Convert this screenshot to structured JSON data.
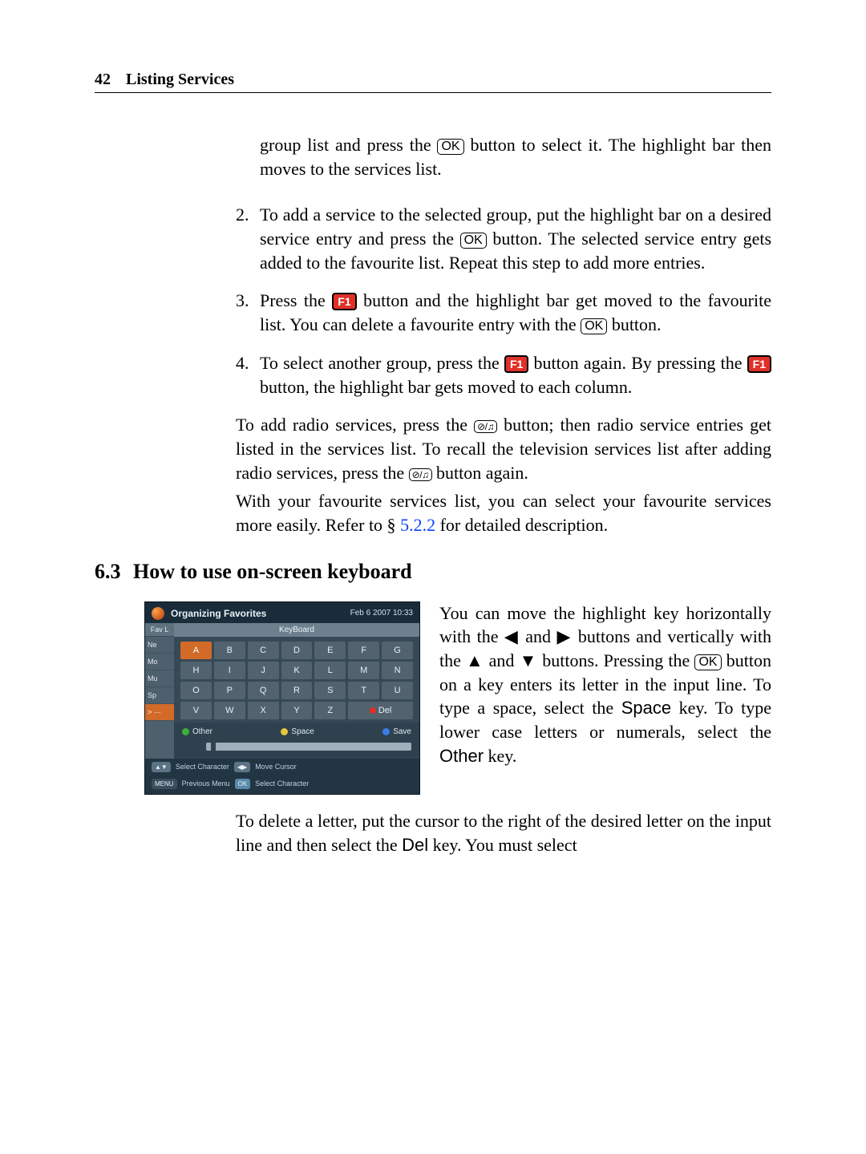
{
  "header": {
    "page_number": "42",
    "chapter_title": "Listing Services"
  },
  "keys": {
    "ok": "OK",
    "f1": "F1",
    "tvradio": "⊘/♫"
  },
  "content": {
    "intro_tail": "group list and press the ",
    "intro_tail_b": " button to select it. The highlight bar then moves to the services list.",
    "step2_a": "To add a service to the selected group, put the highlight bar on a desired service entry and press the ",
    "step2_b": " button. The selected service entry gets added to the favourite list. Repeat this step to add more entries.",
    "step3_a": "Press the ",
    "step3_b": " button and the highlight bar get moved to the favourite list. You can delete a favourite entry with the ",
    "step3_c": " button.",
    "step4_a": "To select another group, press the ",
    "step4_b": " button again. By pressing the ",
    "step4_c": " button, the highlight bar gets moved to each column.",
    "radio_a": "To add radio services, press the ",
    "radio_b": " button; then radio service entries get listed in the services list. To recall the television services list after adding radio services, press the ",
    "radio_c": " button again.",
    "fav_note_a": "With your favourite services list, you can select your favourite services more easily. Refer to § ",
    "fav_note_link": "5.2.2",
    "fav_note_b": " for detailed description.",
    "section_num": "6.3",
    "section_title": "How to use on-screen keyboard",
    "kb_para_a": "You can move the highlight key horizontally with the ",
    "kb_para_b": " and ",
    "kb_para_c": " buttons and vertically with the ",
    "kb_para_d": " and ",
    "kb_para_e": " buttons. Pressing the ",
    "kb_para_f": " button on a key enters its letter in the input line. To type a space, select the ",
    "kb_para_g": " key. To type lower case letters or numerals, select the ",
    "kb_para_h": " key.",
    "arrow_left": "◀",
    "arrow_right": "▶",
    "arrow_up": "▲",
    "arrow_down": "▼",
    "space_key": "Space",
    "other_key": "Other",
    "del_para_a": "To delete a letter, put the cursor to the right of the desired letter on the input line and then select the ",
    "del_key": "Del",
    "del_para_b": " key. You must select"
  },
  "osk": {
    "title": "Organizing Favorites",
    "date": "Feb 6 2007 10:33",
    "left_header": "Fav L",
    "left_items": [
      "Ne",
      "Mo",
      "Mu",
      "Sp",
      ">  ···"
    ],
    "kb_title": "KeyBoard",
    "rows": [
      [
        "A",
        "B",
        "C",
        "D",
        "E",
        "F",
        "G"
      ],
      [
        "H",
        "I",
        "J",
        "K",
        "L",
        "M",
        "N"
      ],
      [
        "O",
        "P",
        "Q",
        "R",
        "S",
        "T",
        "U"
      ],
      [
        "V",
        "W",
        "X",
        "Y",
        "Z",
        "Del",
        ""
      ]
    ],
    "selected_key": "A",
    "controls": {
      "other": "Other",
      "space": "Space",
      "save": "Save"
    },
    "hints": {
      "arrows": "▲▼",
      "select_char": "Select Character",
      "lr": "◀▶",
      "move_cursor": "Move Cursor",
      "menu": "MENU",
      "prev_menu": "Previous Menu",
      "ok": "OK",
      "select_char2": "Select Character"
    }
  }
}
